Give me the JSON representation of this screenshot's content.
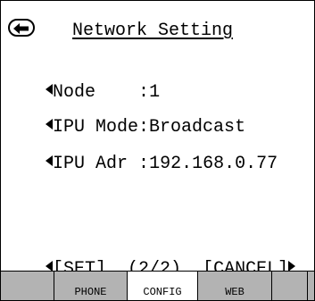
{
  "header": {
    "title": "Network Setting",
    "back_icon": "back-arrow-icon"
  },
  "fields": [
    {
      "label": "Node",
      "separator": ":",
      "value": "1"
    },
    {
      "label": "IPU Mode",
      "separator": ":",
      "value": "Broadcast"
    },
    {
      "label": "IPU Adr",
      "separator": ":",
      "value": "192.168.0.77"
    }
  ],
  "footer": {
    "set_label": "[SET]",
    "page_indicator": "(2/2)",
    "cancel_label": "[CANCEL]"
  },
  "tabs": [
    {
      "label": ""
    },
    {
      "label": "PHONE"
    },
    {
      "label": "CONFIG",
      "active": true
    },
    {
      "label": "WEB"
    },
    {
      "label": ""
    }
  ],
  "colors": {
    "tab_bar": "#b3b3b3",
    "active_tab": "#ffffff",
    "text": "#000000"
  }
}
